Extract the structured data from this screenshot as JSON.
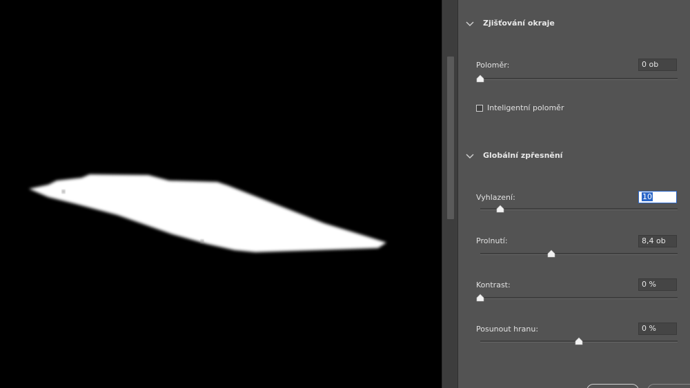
{
  "panel": {
    "edge_detection": {
      "title": "Zjišťování okraje",
      "radius": {
        "label": "Poloměr:",
        "value": "0 ob",
        "level": 0
      },
      "smart_radius": {
        "label": "Inteligentní poloměr",
        "checked": false
      }
    },
    "global_refinements": {
      "title": "Globální zpřesnění",
      "smooth": {
        "label": "Vyhlazení:",
        "value": "10",
        "level": 0.1
      },
      "feather": {
        "label": "Prolnutí:",
        "value": "8,4 ob",
        "level": 0.36
      },
      "contrast": {
        "label": "Kontrast:",
        "value": "0 %",
        "level": 0
      },
      "shift_edge": {
        "label": "Posunout hranu:",
        "value": "0 %",
        "level": 0.5
      }
    }
  },
  "colors": {
    "panel_bg": "#535353",
    "canvas_bg": "#000000",
    "mask_fill": "#ffffff",
    "focus": "#2a66c8"
  },
  "icons": [
    "chevron-down-icon",
    "slider-thumb-icon",
    "checkbox-icon"
  ]
}
